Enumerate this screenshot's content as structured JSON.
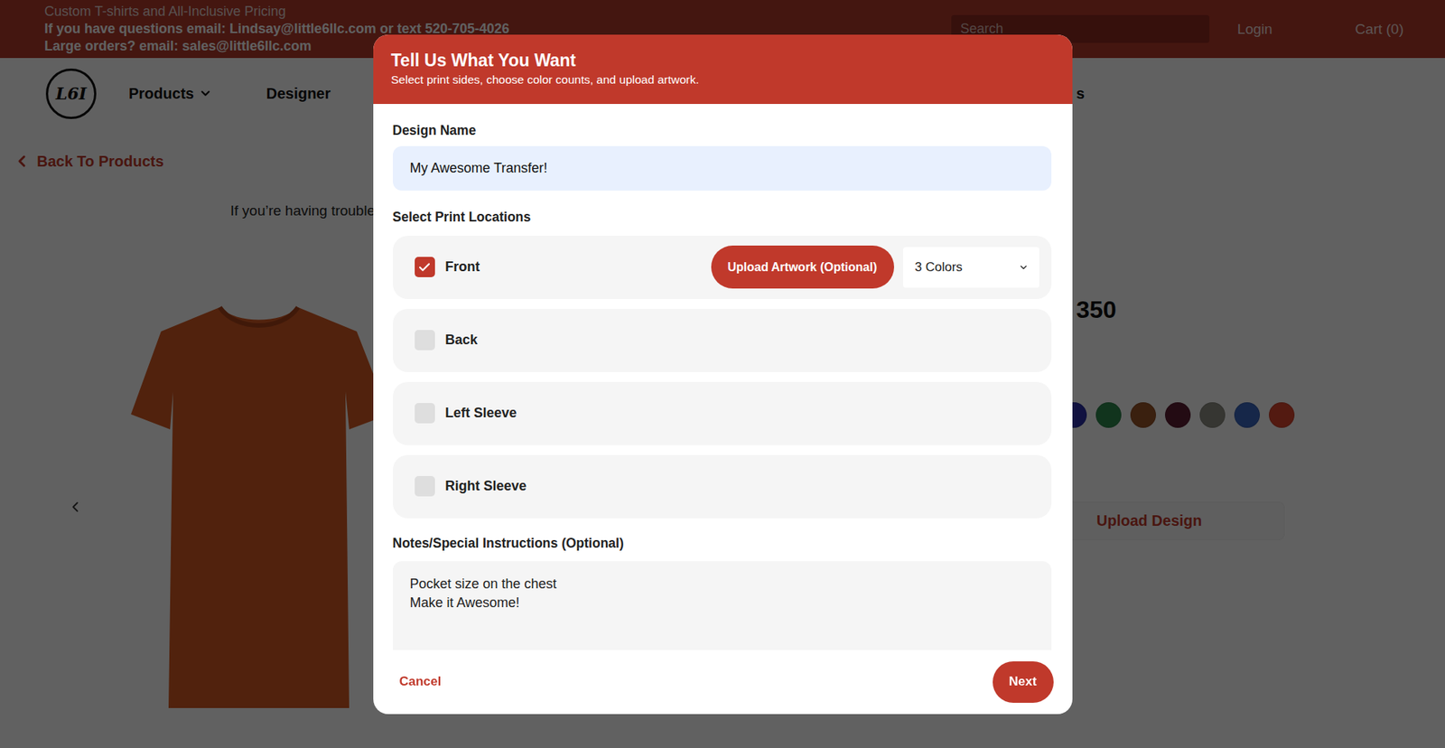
{
  "top_bar": {
    "lines": [
      {
        "text": "Custom T-shirts and All-Inclusive Pricing",
        "bold": false
      },
      {
        "text": "If you have questions email: Lindsay@little6llc.com or text 520-705-4026",
        "bold": true
      },
      {
        "text": "Large orders? email: sales@little6llc.com",
        "bold": true
      }
    ],
    "search": {
      "placeholder": "Search"
    },
    "login": "Login",
    "cart": "Cart (0)"
  },
  "nav": {
    "logo": "L6I",
    "items": [
      {
        "label": "Products",
        "has_menu": true
      },
      {
        "label": "Designer",
        "has_menu": false
      }
    ],
    "cut_item": "s"
  },
  "back_link": "Back To Products",
  "help_text": "If you’re having trouble",
  "product": {
    "name": "350",
    "swatches": [
      {
        "color": "#2a2fa8"
      },
      {
        "color": "#2f8a4e"
      },
      {
        "color": "#9a5428"
      },
      {
        "color": "#5e1d33"
      },
      {
        "color": "#8f8f84"
      },
      {
        "color": "#3a66bf"
      },
      {
        "color": "#d9452e"
      }
    ],
    "upload_button": "Upload Design"
  },
  "modal": {
    "title": "Tell Us What You Want",
    "subtitle": "Select print sides, choose color counts, and upload artwork.",
    "design_name": {
      "label": "Design Name",
      "value": "My Awesome Transfer!"
    },
    "locations_label": "Select Print Locations",
    "locations": [
      {
        "label": "Front",
        "checked": true,
        "upload_button": "Upload Artwork (Optional)",
        "colors": "3 Colors"
      },
      {
        "label": "Back",
        "checked": false
      },
      {
        "label": "Left Sleeve",
        "checked": false
      },
      {
        "label": "Right Sleeve",
        "checked": false
      }
    ],
    "notes": {
      "label": "Notes/Special Instructions (Optional)",
      "value": "Pocket size on the chest\nMake it Awesome!"
    },
    "cancel": "Cancel",
    "next": "Next"
  }
}
